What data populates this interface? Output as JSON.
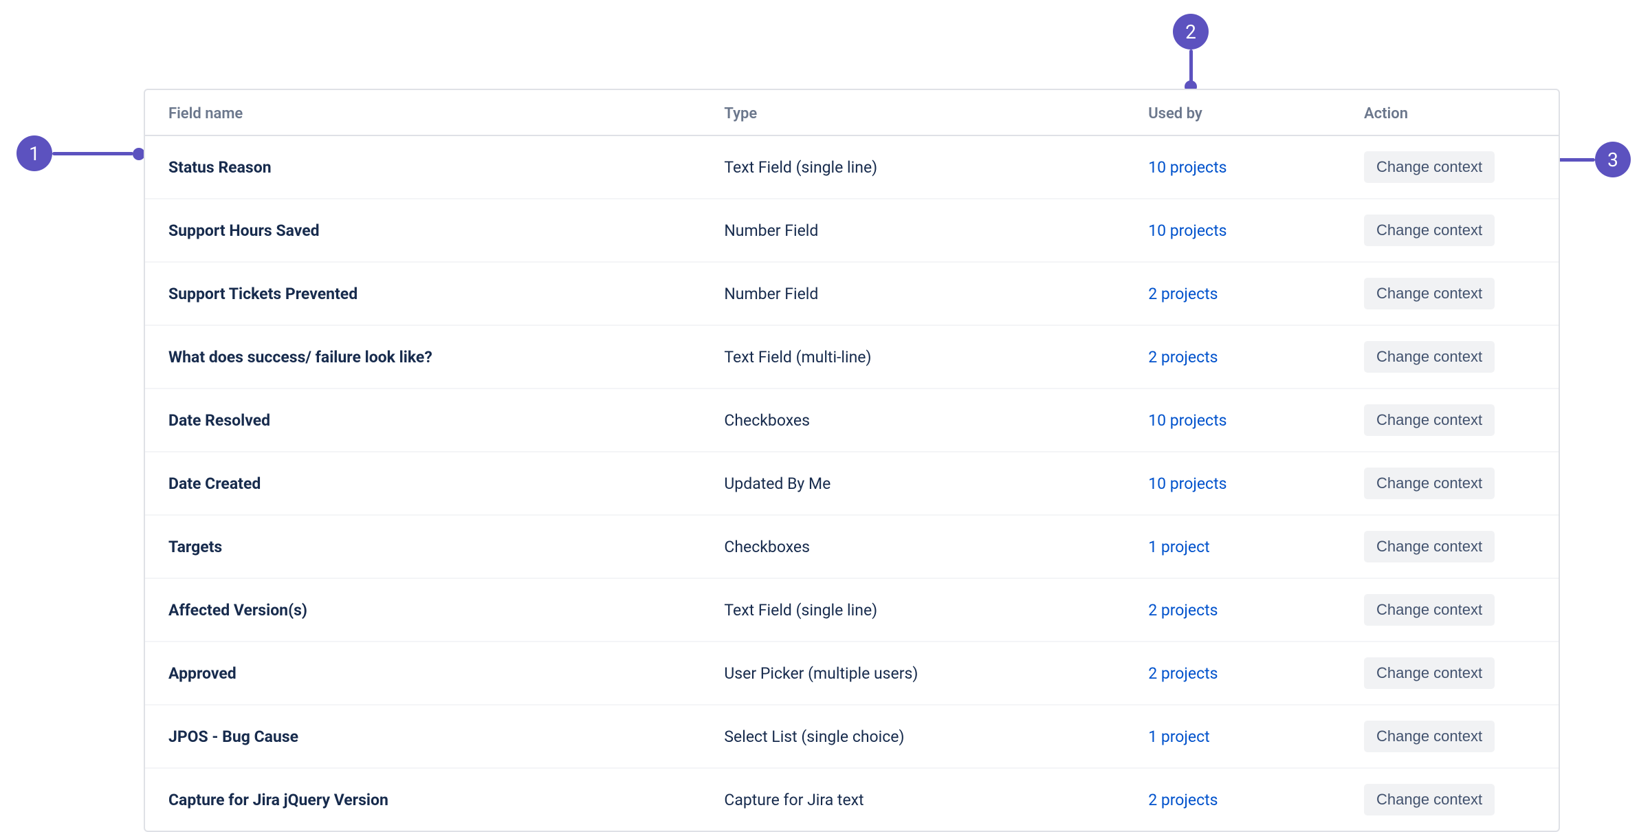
{
  "annotations": {
    "a1": "1",
    "a2": "2",
    "a3": "3"
  },
  "headers": {
    "field_name": "Field name",
    "type": "Type",
    "used_by": "Used by",
    "action": "Action"
  },
  "action_label": "Change context",
  "rows": [
    {
      "name": "Status Reason",
      "type": "Text Field (single line)",
      "used": "10 projects"
    },
    {
      "name": "Support Hours Saved",
      "type": "Number Field",
      "used": "10 projects"
    },
    {
      "name": "Support Tickets Prevented",
      "type": "Number Field",
      "used": "2 projects"
    },
    {
      "name": "What does success/ failure look like?",
      "type": "Text Field (multi-line)",
      "used": "2 projects"
    },
    {
      "name": "Date Resolved",
      "type": "Checkboxes",
      "used": "10 projects"
    },
    {
      "name": "Date Created",
      "type": "Updated By Me",
      "used": "10 projects"
    },
    {
      "name": "Targets",
      "type": "Checkboxes",
      "used": "1 project"
    },
    {
      "name": "Affected Version(s)",
      "type": "Text Field (single line)",
      "used": "2 projects"
    },
    {
      "name": "Approved",
      "type": "User Picker (multiple users)",
      "used": "2 projects"
    },
    {
      "name": "JPOS - Bug Cause",
      "type": "Select List (single choice)",
      "used": "1 project"
    },
    {
      "name": "Capture for Jira jQuery Version",
      "type": "Capture for Jira text",
      "used": "2 projects"
    }
  ]
}
